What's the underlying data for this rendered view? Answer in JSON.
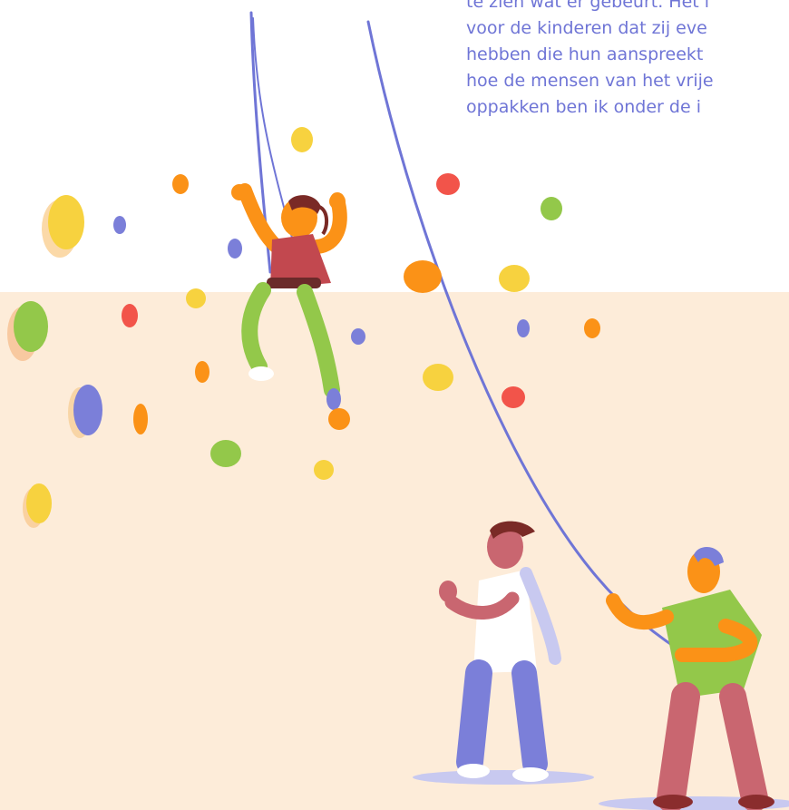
{
  "text_lines": [
    "te zien wat er gebeurt. Het i",
    "voor de kinderen dat zij eve",
    "hebben die hun aanspreekt",
    "hoe de mensen van het vrije",
    "oppakken ben ik onder de i"
  ],
  "colors": {
    "wall_upper": "#ffffff",
    "wall_lower": "#fdecd9",
    "text": "#6f75d6",
    "rope": "#6f75d6",
    "hold_yellow": "#f7d23f",
    "hold_orange": "#fb9217",
    "hold_red": "#f2544a",
    "hold_green": "#93c84a",
    "hold_blue": "#7b7fd9"
  }
}
